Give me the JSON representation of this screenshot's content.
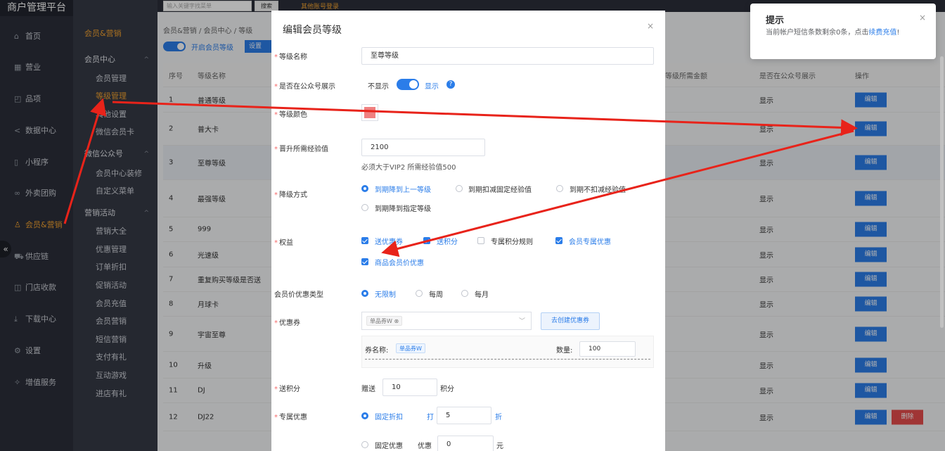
{
  "app": {
    "brand": "商户管理平台"
  },
  "topbar": {
    "search_placeholder": "输入关键字找菜单",
    "search_btn": "搜索",
    "other_account": "其他账号登录"
  },
  "sidebar": {
    "items": [
      {
        "icon": "home-icon",
        "glyph": "⌂",
        "label": "首页"
      },
      {
        "icon": "calendar-icon",
        "glyph": "▦",
        "label": "营业"
      },
      {
        "icon": "bag-icon",
        "glyph": "◰",
        "label": "品项"
      },
      {
        "icon": "share-icon",
        "glyph": "<",
        "label": "数据中心"
      },
      {
        "icon": "tablet-icon",
        "glyph": "▯",
        "label": "小程序"
      },
      {
        "icon": "group-icon",
        "glyph": "∞",
        "label": "外卖团购"
      },
      {
        "icon": "user-icon",
        "glyph": "♙",
        "label": "会员&营销"
      },
      {
        "icon": "truck-icon",
        "glyph": "⛟",
        "label": "供应链"
      },
      {
        "icon": "wallet-icon",
        "glyph": "◫",
        "label": "门店收款"
      },
      {
        "icon": "download-icon",
        "glyph": "⤓",
        "label": "下载中心"
      },
      {
        "icon": "gear-icon",
        "glyph": "⚙",
        "label": "设置"
      },
      {
        "icon": "star-icon",
        "glyph": "✧",
        "label": "增值服务"
      }
    ],
    "collapse": "«"
  },
  "subnav": {
    "header": "会员&营销",
    "groups": [
      {
        "title": "会员中心",
        "items": [
          "会员管理",
          "等级管理",
          "其他设置",
          "微信会员卡"
        ]
      },
      {
        "title": "微信公众号",
        "items": [
          "会员中心装修",
          "自定义菜单"
        ]
      },
      {
        "title": "营销活动",
        "items": [
          "营销大全",
          "优惠管理",
          "订单折扣",
          "促销活动",
          "会员充值",
          "会员营销",
          "短信营销",
          "支付有礼",
          "互动游戏",
          "进店有礼"
        ]
      }
    ],
    "active": "等级管理"
  },
  "main": {
    "breadcrumb": "会员&营销 / 会员中心 / 等级",
    "toggle_label": "开启会员等级",
    "settings_btn": "设置",
    "columns": {
      "num": "序号",
      "name": "等级名称",
      "amount": "等级所需金额",
      "public": "是否在公众号展示",
      "op": "操作"
    },
    "rows": [
      {
        "num": "1",
        "name": "普通等级",
        "public": "显示"
      },
      {
        "num": "2",
        "name": "普大卡",
        "public": "显示"
      },
      {
        "num": "3",
        "name": "至尊等级",
        "public": "显示"
      },
      {
        "num": "4",
        "name": "最强等级",
        "public": "显示"
      },
      {
        "num": "5",
        "name": "999",
        "public": "显示"
      },
      {
        "num": "6",
        "name": "光速级",
        "public": "显示"
      },
      {
        "num": "7",
        "name": "重复购买等级是否送",
        "public": "显示"
      },
      {
        "num": "8",
        "name": "月球卡",
        "public": "显示"
      },
      {
        "num": "9",
        "name": "宇宙至尊",
        "public": "显示"
      },
      {
        "num": "10",
        "name": "升级",
        "public": "显示"
      },
      {
        "num": "11",
        "name": "DJ",
        "public": "显示"
      },
      {
        "num": "12",
        "name": "DJ22",
        "public": "显示"
      }
    ],
    "edit_label": "编辑",
    "delete_label": "删除"
  },
  "modal": {
    "title": "编辑会员等级",
    "close": "×",
    "level_name_label": "等级名称",
    "level_name_value": "至尊等级",
    "public_label": "是否在公众号展示",
    "public_off": "不显示",
    "public_on": "显示",
    "help": "?",
    "color_label": "等级颜色",
    "color_value": "#f08080",
    "exp_label": "晋升所需经验值",
    "exp_value": "2100",
    "exp_hint": "必须大于VIP2 所需经验值500",
    "downgrade_label": "降级方式",
    "downgrade_options": [
      "到期降到上一等级",
      "到期扣减固定经验值",
      "到期不扣减经验值",
      "到期降到指定等级"
    ],
    "rights_label": "权益",
    "rights_options": [
      "送优惠券",
      "送积分",
      "专属积分规则",
      "会员专属优惠",
      "商品会员价优惠"
    ],
    "member_price_label": "会员价优惠类型",
    "member_price_options": [
      "无限制",
      "每周",
      "每月"
    ],
    "coupon_label": "优惠券",
    "coupon_tag": "单品券W",
    "create_coupon": "去创建优惠券",
    "coupon_name_label": "券名称:",
    "coupon_name_tag": "单品券W",
    "qty_label": "数量:",
    "qty_value": "100",
    "points_label": "送积分",
    "points_prefix": "赠送",
    "points_value": "10",
    "points_suffix": "积分",
    "exclusive_label": "专属优惠",
    "fixed_discount": "固定折扣",
    "discount_prefix": "打",
    "discount_value": "5",
    "discount_suffix": "折",
    "fixed_amount": "固定优惠",
    "amount_prefix": "优惠",
    "amount_value": "0",
    "amount_suffix": "元"
  },
  "toast": {
    "title": "提示",
    "close": "×",
    "body": "当前帐户短信条数剩余0条，点击",
    "link": "续费充值",
    "tail": "!"
  },
  "colors": {
    "primary": "#2b7de9",
    "accent": "#f0a030",
    "danger": "#e64c4c",
    "annotation": "#e8231a"
  }
}
